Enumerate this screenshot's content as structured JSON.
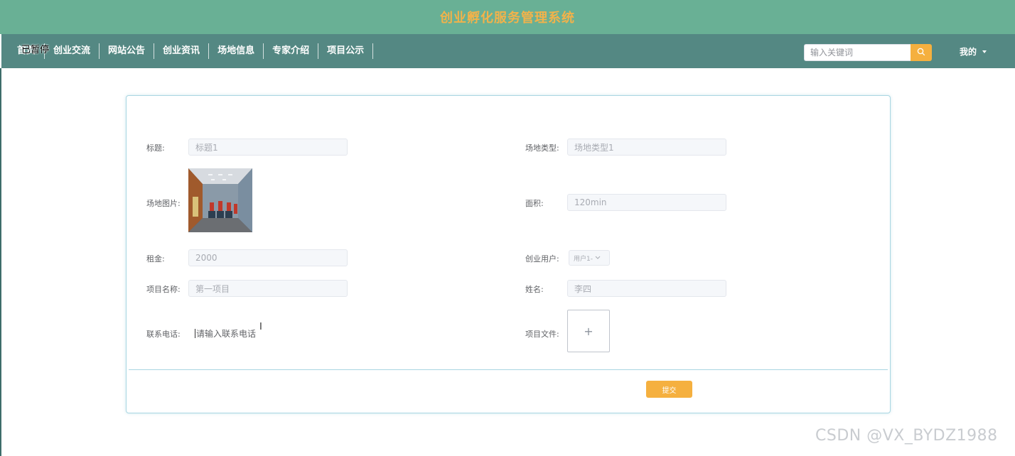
{
  "header": {
    "title": "创业孵化服务管理系统"
  },
  "nav": {
    "items": [
      "首页",
      "创业交流",
      "网站公告",
      "创业资讯",
      "场地信息",
      "专家介绍",
      "项目公示"
    ]
  },
  "overlay": {
    "paused_label": "已暂停"
  },
  "search": {
    "placeholder": "输入关键词",
    "icon": "search-icon"
  },
  "user_menu": {
    "label": "我的"
  },
  "form": {
    "title_label": "标题:",
    "title_value": "标题1",
    "venue_type_label": "场地类型:",
    "venue_type_value": "场地类型1",
    "venue_image_label": "场地图片:",
    "area_label": "面积:",
    "area_value": "120min",
    "rent_label": "租金:",
    "rent_value": "2000",
    "user_label": "创业用户:",
    "user_value": "用户1-",
    "project_name_label": "项目名称:",
    "project_name_value": "第一项目",
    "name_label": "姓名:",
    "name_value": "李四",
    "phone_label": "联系电话:",
    "phone_placeholder": "请输入联系电话",
    "project_file_label": "项目文件:",
    "upload_symbol": "+",
    "submit_label": "提交"
  },
  "watermark": {
    "text": "CSDN @VX_BYDZ1988"
  },
  "colors": {
    "header": "#69b095",
    "navbar": "#548883",
    "accent": "#f5b03f",
    "title_text": "#f2b24a"
  }
}
